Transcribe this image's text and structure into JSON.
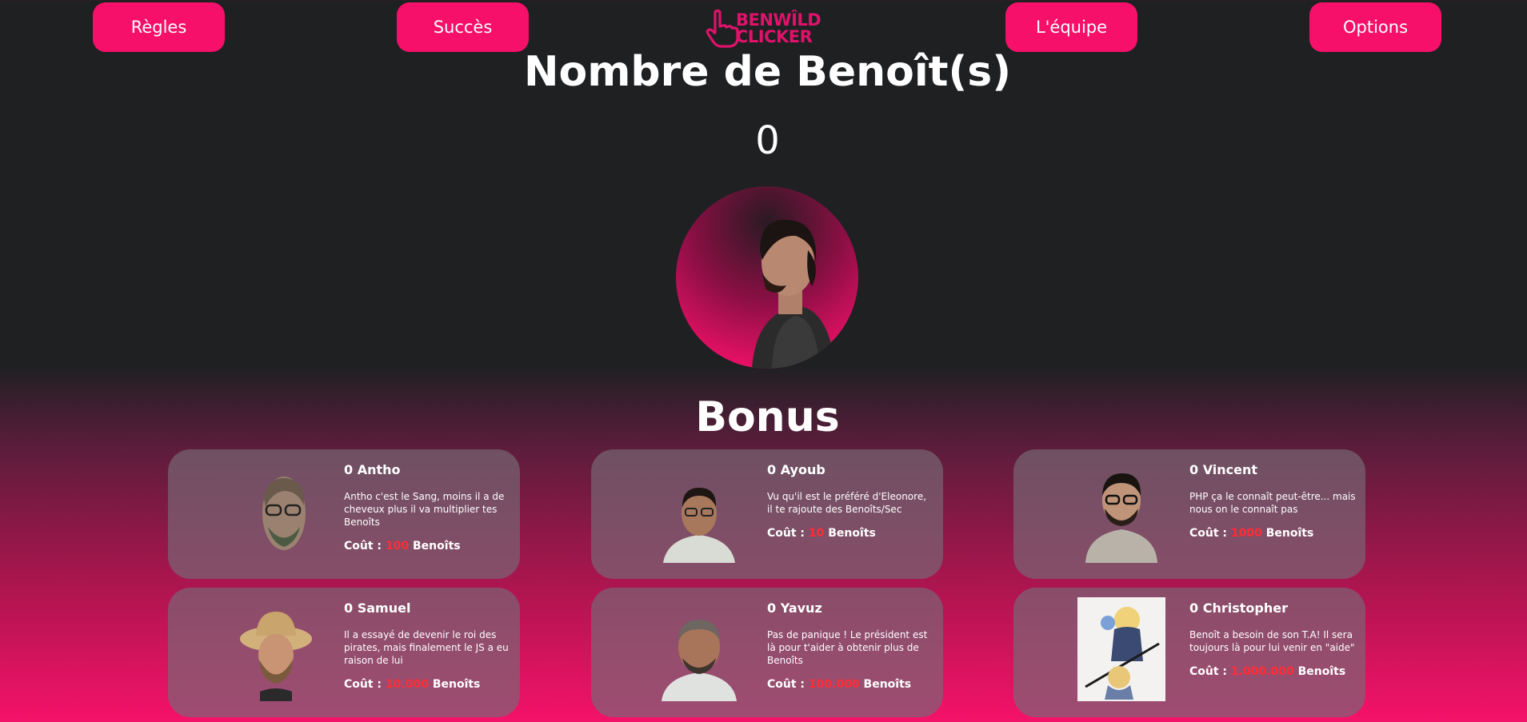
{
  "nav": {
    "rules_label": "Règles",
    "success_label": "Succès",
    "team_label": "L'équipe",
    "options_label": "Options"
  },
  "logo": {
    "line1": "BENWÎLD",
    "line2": "CLICKER"
  },
  "counter": {
    "title": "Nombre de Benoît(s)",
    "value": "0"
  },
  "bonus": {
    "title": "Bonus",
    "cost_label": "Coût :",
    "currency": "Benoîts",
    "items": [
      {
        "name": "0 Antho",
        "description": "Antho c'est le Sang, moins il a de cheveux plus il va multiplier tes Benoîts",
        "price": "100"
      },
      {
        "name": "0 Ayoub",
        "description": "Vu qu'il est le préféré d'Eleonore, il te rajoute des Benoîts/Sec",
        "price": "10"
      },
      {
        "name": "0 Vincent",
        "description": "PHP ça le connaît peut-être... mais nous on le connaît pas",
        "price": "1000"
      },
      {
        "name": "0 Samuel",
        "description": "Il a essayé de devenir le roi des pirates, mais finalement le JS a eu raison de lui",
        "price": "10.000"
      },
      {
        "name": "0 Yavuz",
        "description": "Pas de panique ! Le président est là pour t'aider à obtenir plus de Benoîts",
        "price": "100.000"
      },
      {
        "name": "0 Christopher",
        "description": "Benoît a besoin de son T.A! Il sera toujours là pour lui venir en \"aide\"",
        "price": "1.000.000"
      }
    ]
  },
  "colors": {
    "accent": "#f7106a",
    "price": "#ff2d35",
    "background": "#1e2022"
  }
}
